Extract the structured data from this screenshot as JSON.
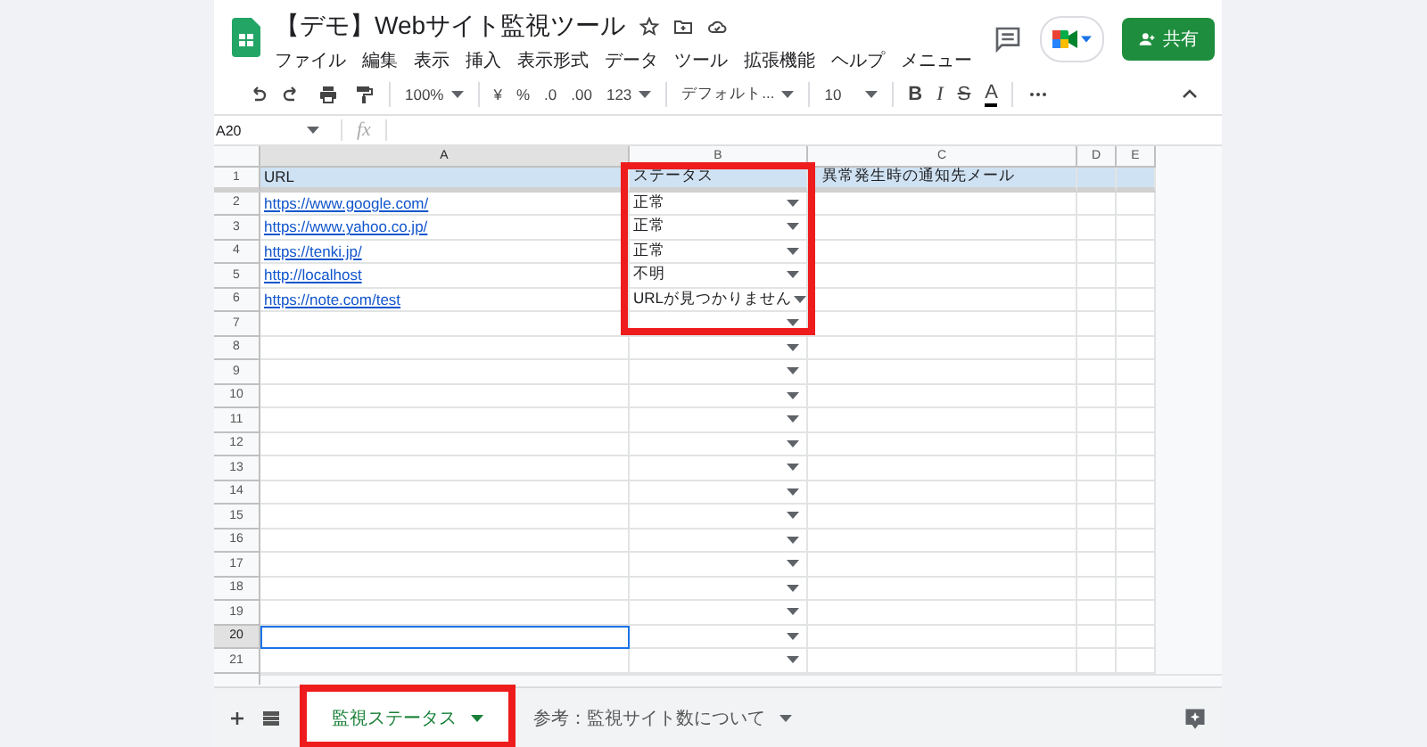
{
  "document": {
    "title": "【デモ】Webサイト監視ツール"
  },
  "menu": [
    "ファイル",
    "編集",
    "表示",
    "挿入",
    "表示形式",
    "データ",
    "ツール",
    "拡張機能",
    "ヘルプ",
    "メニュー"
  ],
  "share_button": "共有",
  "toolbar": {
    "zoom": "100%",
    "currency": "¥",
    "percent": "%",
    "decrease_decimals": ".0",
    "increase_decimals": ".00",
    "number_format": "123",
    "font": "デフォルト...",
    "font_size": "10",
    "bold": "B",
    "italic": "I",
    "strikethrough": "S",
    "text_color": "A"
  },
  "name_box": "A20",
  "formula_label": "fx",
  "columns": [
    {
      "label": "A",
      "selected": true,
      "highlighted": false
    },
    {
      "label": "B",
      "selected": false,
      "highlighted": true
    },
    {
      "label": "C",
      "selected": false,
      "highlighted": false
    },
    {
      "label": "D",
      "selected": false,
      "highlighted": false
    },
    {
      "label": "E",
      "selected": false,
      "highlighted": false
    }
  ],
  "rows": [
    {
      "number": "1",
      "kind": "header",
      "cells": [
        "URL",
        "ステータス",
        "異常発生時の通知先メール"
      ],
      "dropdown": false,
      "selected": false
    },
    {
      "number": "2",
      "kind": "data",
      "cells": [
        "https://www.google.com/",
        "正常"
      ],
      "dropdown": true,
      "selected": false
    },
    {
      "number": "3",
      "kind": "data",
      "cells": [
        "https://www.yahoo.co.jp/",
        "正常"
      ],
      "dropdown": true,
      "selected": false
    },
    {
      "number": "4",
      "kind": "data",
      "cells": [
        "https://tenki.jp/",
        "正常"
      ],
      "dropdown": true,
      "selected": false
    },
    {
      "number": "5",
      "kind": "data",
      "cells": [
        "http://localhost",
        "不明"
      ],
      "dropdown": true,
      "selected": false
    },
    {
      "number": "6",
      "kind": "data",
      "cells": [
        "https://note.com/test",
        "URLが見つかりません"
      ],
      "dropdown": true,
      "selected": false
    },
    {
      "number": "7",
      "kind": "data",
      "cells": [],
      "dropdown": true,
      "selected": false
    },
    {
      "number": "8",
      "kind": "data",
      "cells": [],
      "dropdown": true,
      "selected": false
    },
    {
      "number": "9",
      "kind": "data",
      "cells": [],
      "dropdown": true,
      "selected": false
    },
    {
      "number": "10",
      "kind": "data",
      "cells": [],
      "dropdown": true,
      "selected": false
    },
    {
      "number": "11",
      "kind": "data",
      "cells": [],
      "dropdown": true,
      "selected": false
    },
    {
      "number": "12",
      "kind": "data",
      "cells": [],
      "dropdown": true,
      "selected": false
    },
    {
      "number": "13",
      "kind": "data",
      "cells": [],
      "dropdown": true,
      "selected": false
    },
    {
      "number": "14",
      "kind": "data",
      "cells": [],
      "dropdown": true,
      "selected": false
    },
    {
      "number": "15",
      "kind": "data",
      "cells": [],
      "dropdown": true,
      "selected": false
    },
    {
      "number": "16",
      "kind": "data",
      "cells": [],
      "dropdown": true,
      "selected": false
    },
    {
      "number": "17",
      "kind": "data",
      "cells": [],
      "dropdown": true,
      "selected": false
    },
    {
      "number": "18",
      "kind": "data",
      "cells": [],
      "dropdown": true,
      "selected": false
    },
    {
      "number": "19",
      "kind": "data",
      "cells": [],
      "dropdown": true,
      "selected": false
    },
    {
      "number": "20",
      "kind": "data",
      "cells": [],
      "dropdown": true,
      "selected": true
    },
    {
      "number": "21",
      "kind": "data",
      "cells": [],
      "dropdown": true,
      "selected": false
    }
  ],
  "sheet_tabs": [
    {
      "label": "監視ステータス",
      "selected": true,
      "highlighted": true
    },
    {
      "label": "参考：監視サイト数について",
      "selected": false,
      "highlighted": false
    }
  ]
}
